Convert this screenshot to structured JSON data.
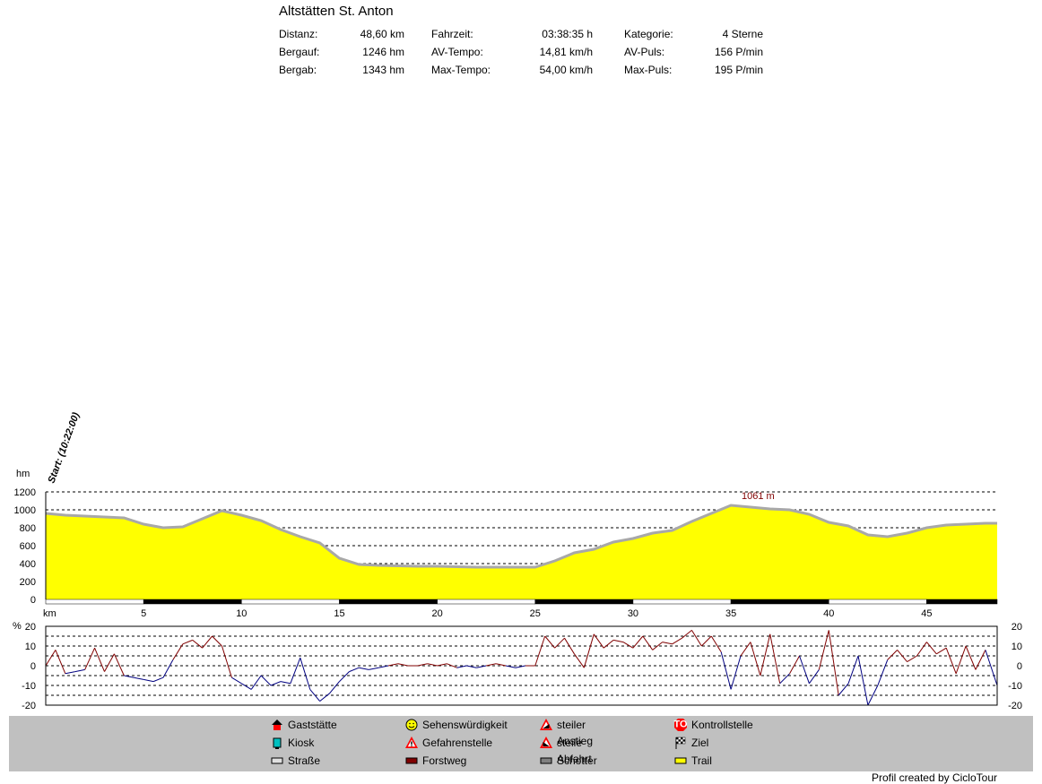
{
  "title": "Altstätten St. Anton",
  "stats": [
    {
      "label": "Distanz:",
      "value": "48,60 km"
    },
    {
      "label": "Bergauf:",
      "value": "1246 hm"
    },
    {
      "label": "Bergab:",
      "value": "1343 hm"
    },
    {
      "label": "Fahrzeit:",
      "value": "03:38:35 h"
    },
    {
      "label": "AV-Tempo:",
      "value": "14,81 km/h"
    },
    {
      "label": "Max-Tempo:",
      "value": "54,00 km/h"
    },
    {
      "label": "Kategorie:",
      "value": "4 Sterne"
    },
    {
      "label": "AV-Puls:",
      "value": "156 P/min"
    },
    {
      "label": "Max-Puls:",
      "value": "195 P/min"
    }
  ],
  "start_label": "Start: (10:22:00)",
  "colors": {
    "fill": "#ffff00",
    "profile_line": "#a8a8a8",
    "gradient_up": "#800000",
    "gradient_down": "#000080",
    "legend_bg": "#c0c0c0"
  },
  "chart_data": [
    {
      "type": "area",
      "ylabel": "hm",
      "xlabel": "km",
      "xlim": [
        0,
        48.6
      ],
      "ylim": [
        0,
        1200
      ],
      "yticks": [
        "1200",
        "1000",
        "800",
        "600",
        "400",
        "200",
        "0"
      ],
      "xticks": [
        "5",
        "10",
        "15",
        "20",
        "25",
        "30",
        "35",
        "40",
        "45"
      ],
      "max_label": "1061 m",
      "x": [
        0,
        1,
        2,
        3,
        4,
        5,
        6,
        7,
        8,
        9,
        10,
        11,
        12,
        13,
        14,
        15,
        16,
        17,
        18,
        19,
        20,
        21,
        22,
        23,
        24,
        25,
        26,
        27,
        28,
        29,
        30,
        31,
        32,
        33,
        34,
        35,
        36,
        37,
        38,
        39,
        40,
        41,
        42,
        43,
        44,
        45,
        46,
        47,
        48,
        48.6
      ],
      "y": [
        960,
        940,
        930,
        920,
        910,
        840,
        800,
        810,
        900,
        990,
        940,
        880,
        780,
        700,
        630,
        460,
        390,
        380,
        375,
        370,
        370,
        365,
        360,
        360,
        360,
        360,
        430,
        520,
        560,
        640,
        680,
        740,
        770,
        870,
        960,
        1050,
        1030,
        1010,
        1000,
        950,
        860,
        820,
        720,
        700,
        740,
        800,
        830,
        840,
        850,
        850
      ]
    },
    {
      "type": "line",
      "ylabel": "%",
      "xlim": [
        0,
        48.6
      ],
      "ylim": [
        -20,
        20
      ],
      "yticks": [
        "20",
        "10",
        "0",
        "-10",
        "-20"
      ],
      "x": [
        0,
        0.5,
        1,
        1.5,
        2,
        2.5,
        3,
        3.5,
        4,
        4.5,
        5,
        5.5,
        6,
        6.5,
        7,
        7.5,
        8,
        8.5,
        9,
        9.5,
        10,
        10.5,
        11,
        11.5,
        12,
        12.5,
        13,
        13.5,
        14,
        14.5,
        15,
        15.5,
        16,
        16.5,
        17,
        17.5,
        18,
        18.5,
        19,
        19.5,
        20,
        20.5,
        21,
        21.5,
        22,
        22.5,
        23,
        23.5,
        24,
        24.5,
        25,
        25.5,
        26,
        26.5,
        27,
        27.5,
        28,
        28.5,
        29,
        29.5,
        30,
        30.5,
        31,
        31.5,
        32,
        32.5,
        33,
        33.5,
        34,
        34.5,
        35,
        35.5,
        36,
        36.5,
        37,
        37.5,
        38,
        38.5,
        39,
        39.5,
        40,
        40.5,
        41,
        41.5,
        42,
        42.5,
        43,
        43.5,
        44,
        44.5,
        45,
        45.5,
        46,
        46.5,
        47,
        47.5,
        48,
        48.6
      ],
      "y": [
        0,
        8,
        -4,
        -3,
        -2,
        9,
        -3,
        6,
        -5,
        -6,
        -7,
        -8,
        -6,
        3,
        11,
        13,
        9,
        15,
        10,
        -6,
        -9,
        -12,
        -5,
        -10,
        -8,
        -9,
        4,
        -12,
        -18,
        -14,
        -8,
        -3,
        -1,
        -2,
        -1,
        0,
        1,
        0,
        0,
        1,
        0,
        1,
        -1,
        0,
        -1,
        0,
        1,
        0,
        -1,
        0,
        0,
        15,
        9,
        14,
        6,
        -1,
        16,
        9,
        13,
        12,
        9,
        15,
        8,
        12,
        11,
        14,
        18,
        10,
        15,
        7,
        -12,
        5,
        12,
        -5,
        16,
        -9,
        -4,
        5,
        -9,
        -2,
        18,
        -15,
        -9,
        5,
        -20,
        -10,
        3,
        8,
        2,
        5,
        12,
        6,
        9,
        -4,
        10,
        -2,
        8,
        -10
      ]
    }
  ],
  "legend": [
    {
      "label": "Gaststätte",
      "icon": "gasthouse-icon"
    },
    {
      "label": "Kiosk",
      "icon": "kiosk-icon"
    },
    {
      "label": "Straße",
      "icon": "road-swatch-icon"
    },
    {
      "label": "Sehenswürdigkeit",
      "icon": "smiley-icon"
    },
    {
      "label": "Gefahrenstelle",
      "icon": "danger-icon"
    },
    {
      "label": "Forstweg",
      "icon": "forest-road-swatch-icon"
    },
    {
      "label": "steiler Anstieg",
      "icon": "steep-ascent-icon"
    },
    {
      "label": "steile Abfahrt",
      "icon": "steep-descent-icon"
    },
    {
      "label": "Schotter",
      "icon": "gravel-swatch-icon"
    },
    {
      "label": "Kontrollstelle",
      "icon": "stop-icon"
    },
    {
      "label": "Ziel",
      "icon": "finish-flag-icon"
    },
    {
      "label": "Trail",
      "icon": "trail-swatch-icon"
    }
  ],
  "credit": "Profil created by CicloTour"
}
